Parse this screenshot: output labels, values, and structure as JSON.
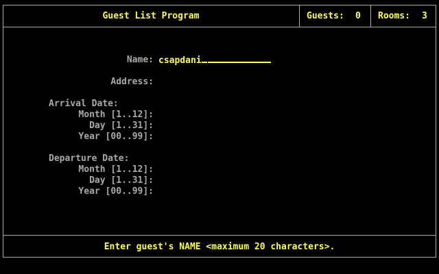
{
  "header": {
    "title": "Guest List Program",
    "guests_label": "Guests:",
    "guests_value": "0",
    "rooms_label": "Rooms:",
    "rooms_value": "3"
  },
  "form": {
    "name_label": "Name:",
    "name_value": "csapdani",
    "address_label": "Address:",
    "arrival_heading": "Arrival Date:",
    "arrival_month_label": "Month [1..12]:",
    "arrival_day_label": "Day [1..31]:",
    "arrival_year_label": "Year [00..99]:",
    "departure_heading": "Departure Date:",
    "departure_month_label": "Month [1..12]:",
    "departure_day_label": "Day [1..31]:",
    "departure_year_label": "Year [00..99]:"
  },
  "status": {
    "message": "Enter guest's NAME <maximum 20 characters>."
  },
  "colors": {
    "background": "#000000",
    "border": "#aaaaaa",
    "label": "#aaaaaa",
    "highlight": "#ffff55"
  }
}
